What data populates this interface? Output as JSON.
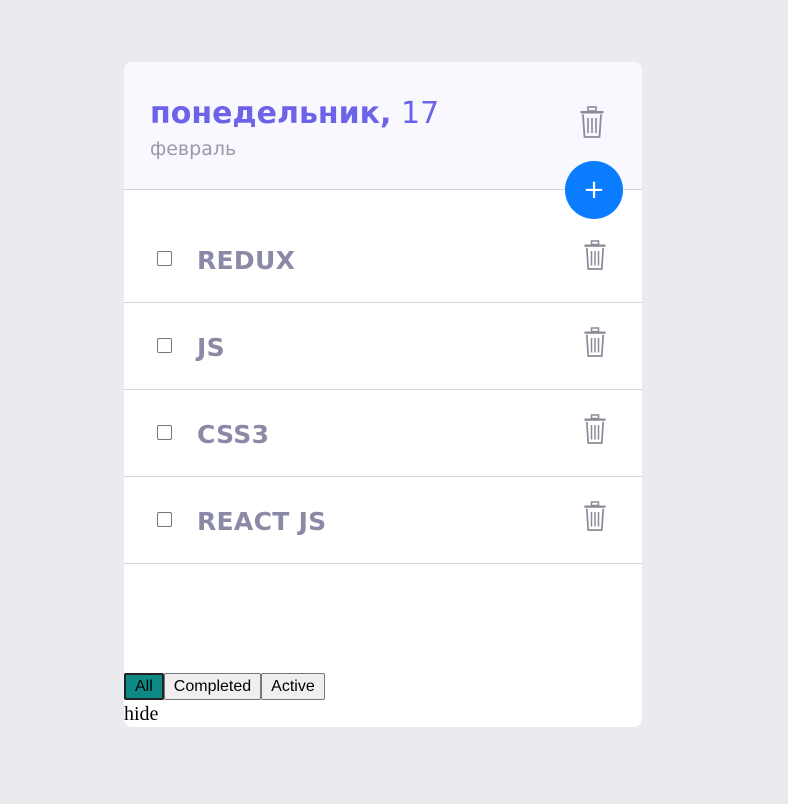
{
  "header": {
    "day_name": "понедельник,",
    "day_number": "17",
    "month": "февраль",
    "add_label": "+"
  },
  "tasks": [
    {
      "label": "REDUX",
      "checked": false
    },
    {
      "label": "JS",
      "checked": false
    },
    {
      "label": "CSS3",
      "checked": false
    },
    {
      "label": "REACT JS",
      "checked": false
    }
  ],
  "filters": {
    "all": "All",
    "completed": "Completed",
    "active": "Active",
    "selected": "All"
  },
  "hide_label": "hide",
  "colors": {
    "accent": "#6c63e8",
    "add_button": "#0a7cff",
    "task_text": "#8a8aa6",
    "active_filter": "#0d8a86"
  },
  "icons": {
    "trash": "trash-icon",
    "add": "plus-icon"
  }
}
